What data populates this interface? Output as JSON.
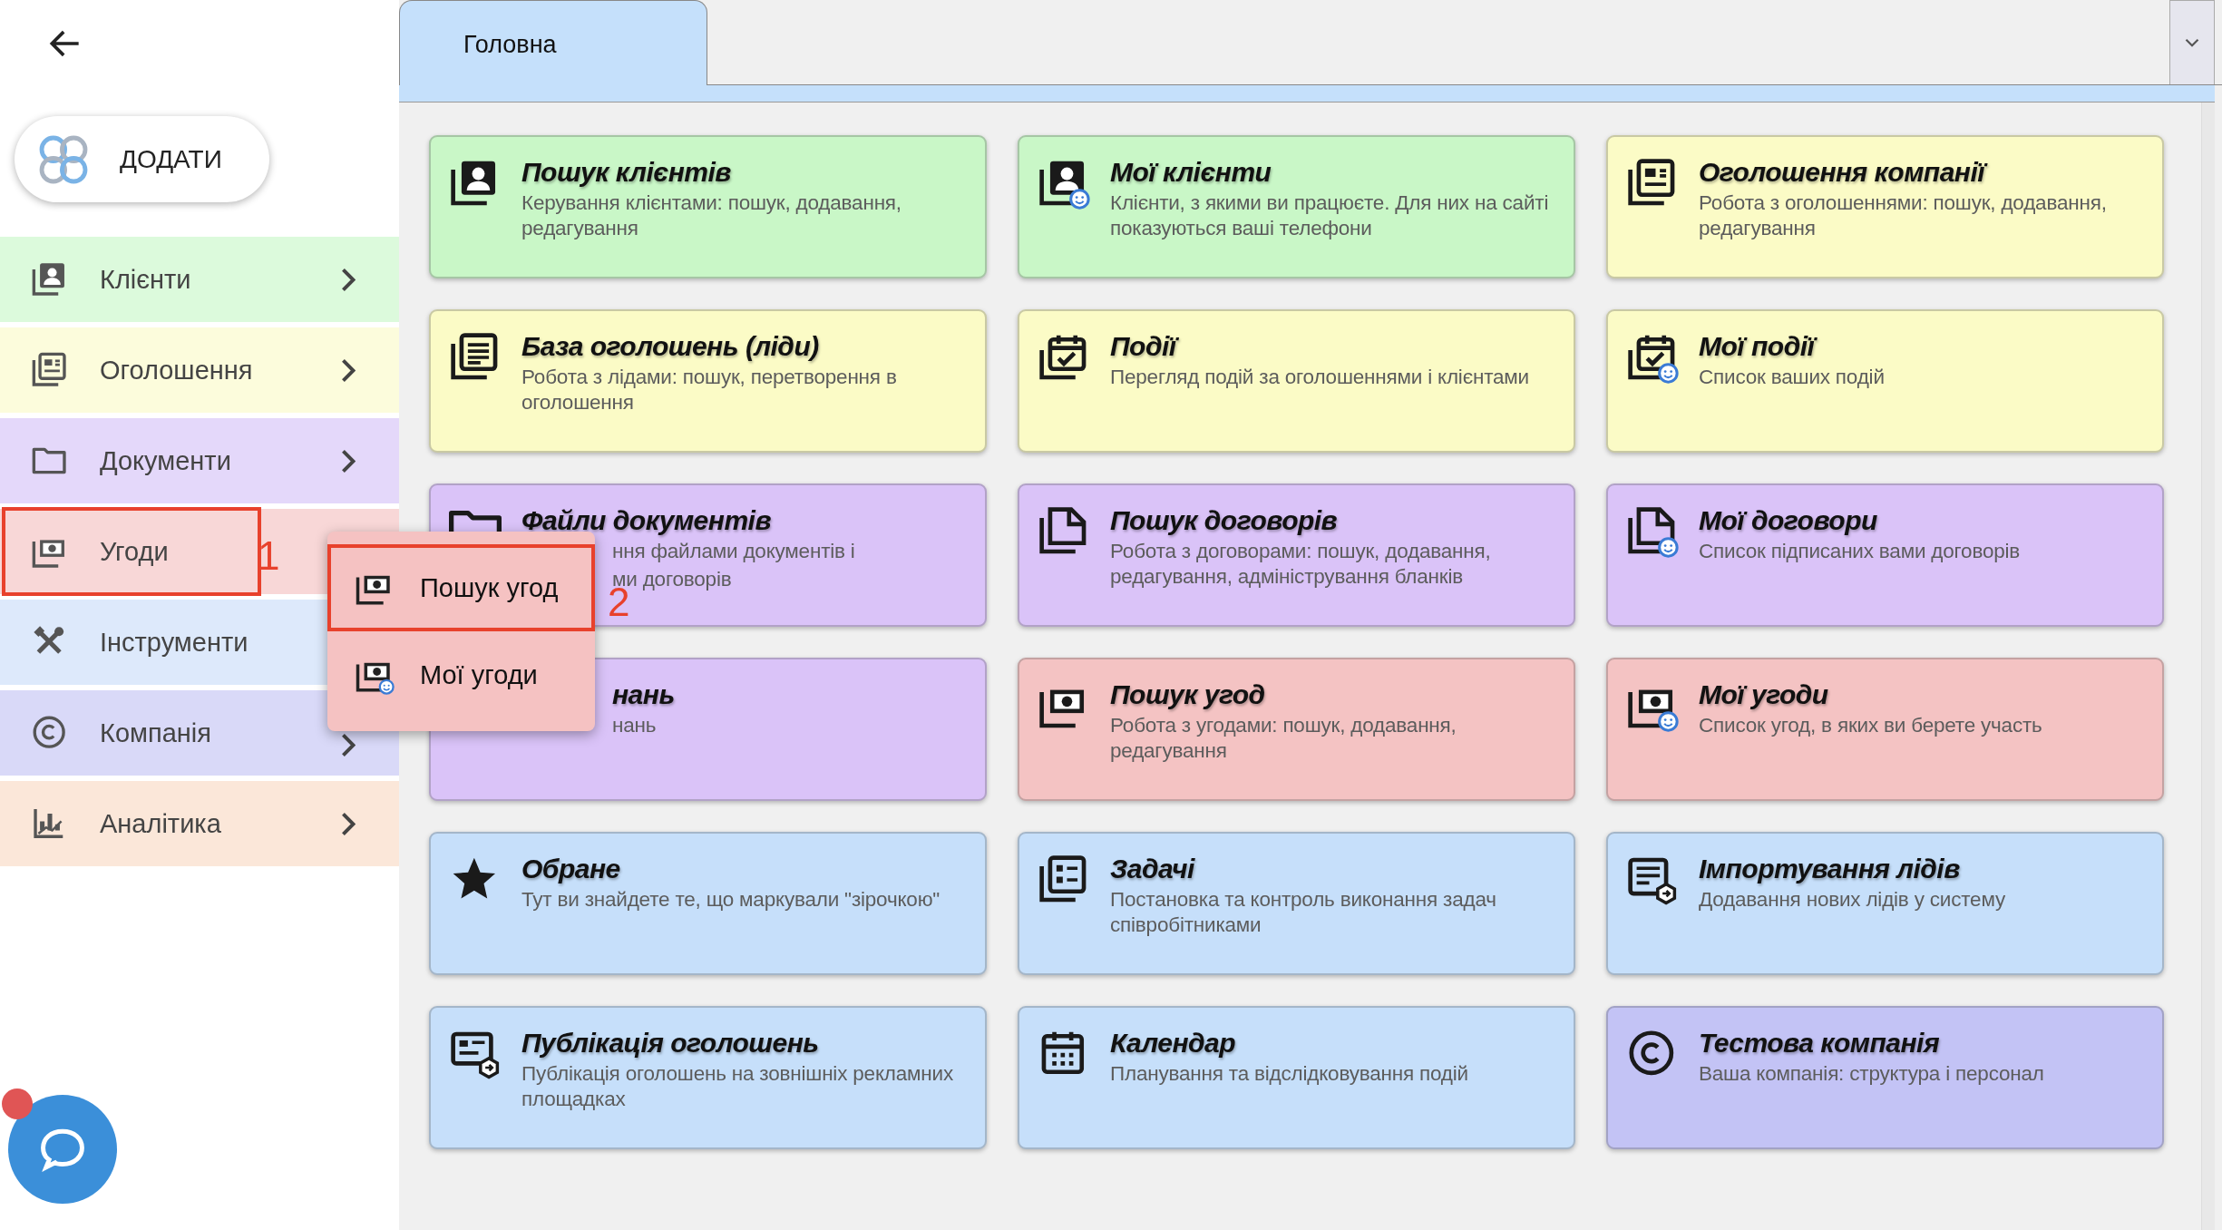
{
  "sidebar": {
    "add_button": {
      "label": "ДОДАТИ"
    },
    "menu": [
      {
        "label": "Клієнти",
        "color": "#dcfadc",
        "chevron": true,
        "highlighted": false
      },
      {
        "label": "Оголошення",
        "color": "#fcfcdc",
        "chevron": true,
        "highlighted": false
      },
      {
        "label": "Документи",
        "color": "#e4d8fa",
        "chevron": true,
        "highlighted": false
      },
      {
        "label": "Угоди",
        "color": "#f8d7d7",
        "chevron": false,
        "highlighted": true,
        "callout": "1",
        "submenu": [
          {
            "label": "Пошук угод",
            "highlighted": true,
            "callout": "2"
          },
          {
            "label": "Мої угоди",
            "highlighted": false
          }
        ]
      },
      {
        "label": "Інструменти",
        "color": "#dde9fb",
        "chevron": false,
        "highlighted": false
      },
      {
        "label": "Компанія",
        "color": "#d9d9f8",
        "chevron": true,
        "highlighted": false
      },
      {
        "label": "Аналітика",
        "color": "#fbe7d9",
        "chevron": true,
        "highlighted": false
      }
    ],
    "chat": {
      "unread": true
    }
  },
  "tabs": [
    {
      "label": "Головна",
      "selected": true
    }
  ],
  "cards": [
    {
      "kind": "full",
      "title": "Пошук клієнтів",
      "description": "Керування клієнтами: пошук, додавання, редагування",
      "color": "#c9f7c7"
    },
    {
      "kind": "full",
      "title": "Мої клієнти",
      "description": "Клієнти, з якими ви працюєте. Для них на сайті показуються ваші телефони",
      "color": "#c9f7c7"
    },
    {
      "kind": "full",
      "title": "Оголошення компанії",
      "description": "Робота з оголошеннями: пошук, додавання, редагування",
      "color": "#fbfbc6"
    },
    {
      "kind": "full",
      "title": "База оголошень (ліди)",
      "description": "Робота з лідами: пошук, перетворення в оголошення",
      "color": "#fbfbc6"
    },
    {
      "kind": "full",
      "title": "Події",
      "description": "Перегляд подій за оголошеннями і клієнтами",
      "color": "#fbfbc6"
    },
    {
      "kind": "full",
      "title": "Мої події",
      "description": "Список ваших подій",
      "color": "#fbfbc6"
    },
    {
      "kind": "covered",
      "title": "Файли документів",
      "description_fragments": [
        "ння файлами документів і",
        "ми договорів"
      ],
      "color": "#dac3f8"
    },
    {
      "kind": "full",
      "title": "Пошук договорів",
      "description": "Робота з договорами: пошук, додавання, редагування, адміністрування бланків",
      "color": "#dac3f8"
    },
    {
      "kind": "full",
      "title": "Мої договори",
      "description": "Список підписаних вами договорів",
      "color": "#dac3f8"
    },
    {
      "kind": "covered",
      "title_fragment": "нань",
      "description_fragments": [
        "нань"
      ],
      "color": "#dac3f8"
    },
    {
      "kind": "full",
      "title": "Пошук угод",
      "description": "Робота з угодами: пошук, додавання, редагування",
      "color": "#f4c3c3"
    },
    {
      "kind": "full",
      "title": "Мої угоди",
      "description": "Список угод, в яких ви берете участь",
      "color": "#f4c3c3"
    },
    {
      "kind": "full",
      "title": "Обране",
      "description": "Тут ви знайдете те, що маркували \"зірочкою\"",
      "color": "#c6dffa"
    },
    {
      "kind": "full",
      "title": "Задачі",
      "description": "Постановка та контроль виконання задач співробітниками",
      "color": "#c6dffa"
    },
    {
      "kind": "full",
      "title": "Імпортування лідів",
      "description": "Додавання нових лідів у систему",
      "color": "#c6dffa"
    },
    {
      "kind": "full",
      "title": "Публікація оголошень",
      "description": "Публікація оголошень на зовнішніх рекламних площадках",
      "color": "#c6dffa"
    },
    {
      "kind": "full",
      "title": "Календар",
      "description": "Планування та відслідковування подій",
      "color": "#c6dffa"
    },
    {
      "kind": "full",
      "title": "Тестова компанія",
      "description": "Ваша компанія: структура і персонал",
      "color": "#c3c3f5"
    }
  ]
}
